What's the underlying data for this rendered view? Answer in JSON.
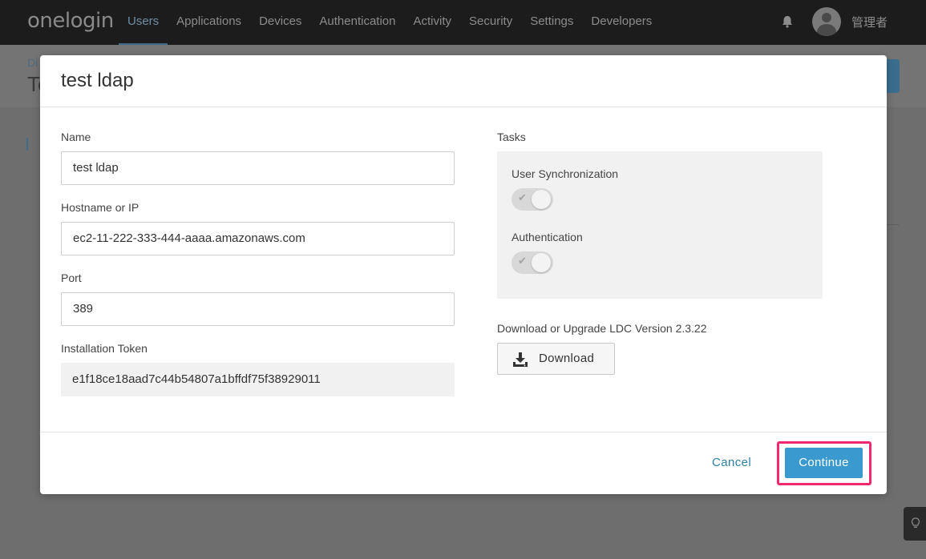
{
  "topbar": {
    "logo": "onelogin",
    "nav": [
      "Users",
      "Applications",
      "Devices",
      "Authentication",
      "Activity",
      "Security",
      "Settings",
      "Developers"
    ],
    "active_nav": "Users",
    "username": "管理者"
  },
  "background": {
    "crumb": "Di",
    "title": "Te"
  },
  "modal": {
    "title": "test ldap",
    "fields": {
      "name_label": "Name",
      "name_value": "test ldap",
      "host_label": "Hostname or IP",
      "host_value": "ec2-11-222-333-444-aaaa.amazonaws.com",
      "port_label": "Port",
      "port_value": "389",
      "token_label": "Installation Token",
      "token_value": "e1f18ce18aad7c44b54807a1bffdf75f38929011"
    },
    "tasks": {
      "label": "Tasks",
      "user_sync_label": "User Synchronization",
      "auth_label": "Authentication"
    },
    "download": {
      "label": "Download or Upgrade LDC Version 2.3.22",
      "button": "Download"
    },
    "footer": {
      "cancel": "Cancel",
      "continue": "Continue"
    }
  },
  "colors": {
    "accent": "#3a9ad0",
    "highlight": "#f2286e",
    "link": "#2d7fa6"
  }
}
